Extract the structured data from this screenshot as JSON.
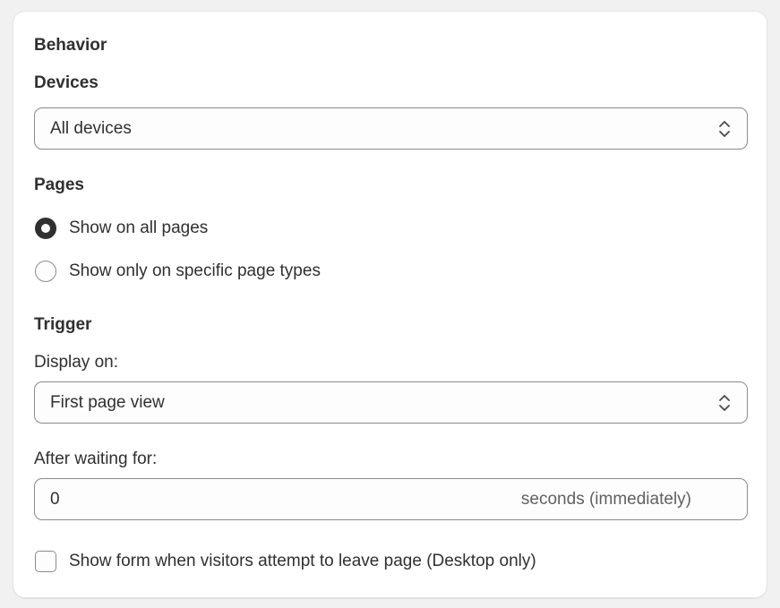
{
  "section": {
    "title": "Behavior"
  },
  "devices": {
    "label": "Devices",
    "selected": "All devices"
  },
  "pages": {
    "label": "Pages",
    "options": [
      {
        "label": "Show on all pages",
        "selected": true
      },
      {
        "label": "Show only on specific page types",
        "selected": false
      }
    ]
  },
  "trigger": {
    "title": "Trigger",
    "display_on_label": "Display on:",
    "display_on_value": "First page view",
    "wait_label": "After waiting for:",
    "wait_value": "0",
    "wait_suffix": "seconds (immediately)"
  },
  "exit_intent": {
    "label": "Show form when visitors attempt to leave page (Desktop only)",
    "checked": false
  },
  "colors": {
    "text": "#303030",
    "border": "#8a8a8a",
    "muted": "#616161",
    "background": "#f1f1f1",
    "card": "#ffffff"
  },
  "icons": {
    "select_chevron": "chevron-up-down-icon"
  }
}
